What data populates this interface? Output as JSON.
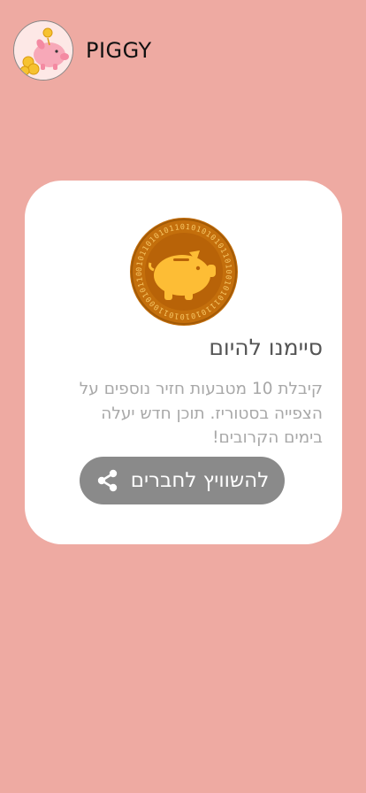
{
  "header": {
    "app_name": "PIGGY",
    "logo_icon": "piggy-bank-logo-icon"
  },
  "card": {
    "coin_icon": "piggy-coin-icon",
    "title": "סיימנו להיום",
    "body": "קיבלת 10 מטבעות חזיר נוספים על הצפייה בסטוריז. תוכן חדש יעלה בימים הקרובים!",
    "share_button": {
      "label": "להשוויץ לחברים",
      "icon": "share-icon"
    }
  },
  "colors": {
    "background": "#eeaaa2",
    "card": "#ffffff",
    "button": "#8a8a8a",
    "coin_outer": "#c46f0c",
    "coin_inner": "#b86308",
    "pig": "#fdbd35"
  }
}
